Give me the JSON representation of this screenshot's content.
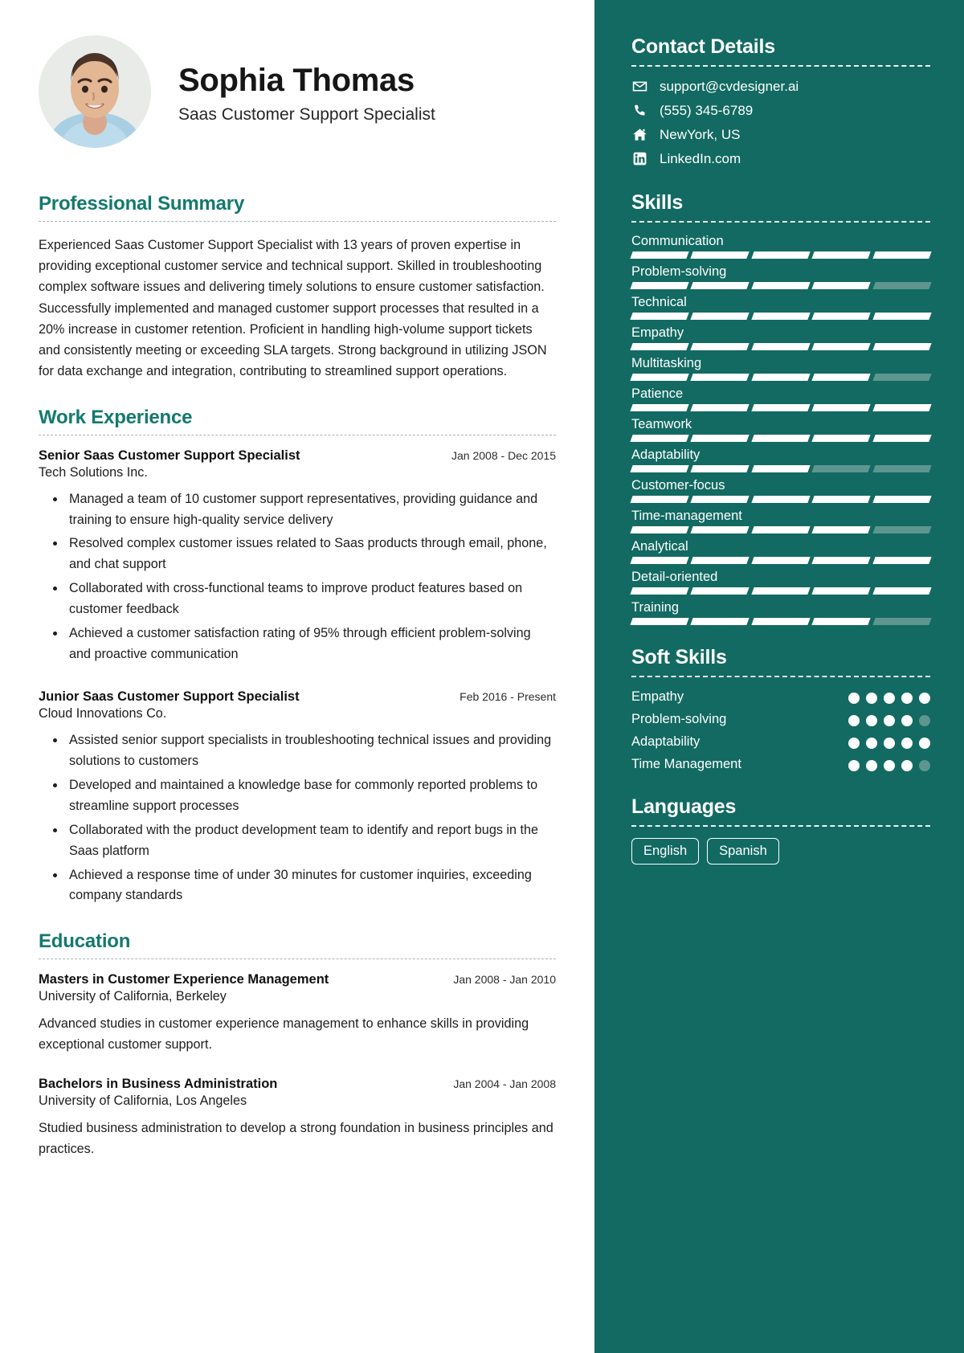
{
  "theme": {
    "accent": "#13796e",
    "sidebar_bg": "#126a62",
    "sidebar_text": "#ffffff",
    "dim": "#5e968f"
  },
  "header": {
    "name": "Sophia Thomas",
    "title": "Saas Customer Support Specialist",
    "avatar_icon": "profile-photo"
  },
  "summary": {
    "heading": "Professional Summary",
    "text": "Experienced Saas Customer Support Specialist with 13 years of proven expertise in providing exceptional customer service and technical support. Skilled in troubleshooting complex software issues and delivering timely solutions to ensure customer satisfaction. Successfully implemented and managed customer support processes that resulted in a 20% increase in customer retention. Proficient in handling high-volume support tickets and consistently meeting or exceeding SLA targets. Strong background in utilizing JSON for data exchange and integration, contributing to streamlined support operations."
  },
  "experience": {
    "heading": "Work Experience",
    "entries": [
      {
        "title": "Senior Saas Customer Support Specialist",
        "date": "Jan 2008 - Dec 2015",
        "org": "Tech Solutions Inc.",
        "bullets": [
          "Managed a team of 10 customer support representatives, providing guidance and training to ensure high-quality service delivery",
          "Resolved complex customer issues related to Saas products through email, phone, and chat support",
          "Collaborated with cross-functional teams to improve product features based on customer feedback",
          "Achieved a customer satisfaction rating of 95% through efficient problem-solving and proactive communication"
        ]
      },
      {
        "title": "Junior Saas Customer Support Specialist",
        "date": "Feb 2016 - Present",
        "org": "Cloud Innovations Co.",
        "bullets": [
          "Assisted senior support specialists in troubleshooting technical issues and providing solutions to customers",
          "Developed and maintained a knowledge base for commonly reported problems to streamline support processes",
          "Collaborated with the product development team to identify and report bugs in the Saas platform",
          "Achieved a response time of under 30 minutes for customer inquiries, exceeding company standards"
        ]
      }
    ]
  },
  "education": {
    "heading": "Education",
    "entries": [
      {
        "title": "Masters in Customer Experience Management",
        "date": "Jan 2008 - Jan 2010",
        "org": "University of California, Berkeley",
        "desc": "Advanced studies in customer experience management to enhance skills in providing exceptional customer support."
      },
      {
        "title": "Bachelors in Business Administration",
        "date": "Jan 2004 - Jan 2008",
        "org": "University of California, Los Angeles",
        "desc": "Studied business administration to develop a strong foundation in business principles and practices."
      }
    ]
  },
  "contact": {
    "heading": "Contact Details",
    "items": [
      {
        "icon": "email-icon",
        "value": "support@cvdesigner.ai"
      },
      {
        "icon": "phone-icon",
        "value": "(555) 345-6789"
      },
      {
        "icon": "home-icon",
        "value": "NewYork, US"
      },
      {
        "icon": "linkedin-icon",
        "value": "LinkedIn.com"
      }
    ]
  },
  "skills": {
    "heading": "Skills",
    "segments_total": 5,
    "items": [
      {
        "name": "Communication",
        "filled": 5
      },
      {
        "name": "Problem-solving",
        "filled": 4
      },
      {
        "name": "Technical",
        "filled": 5
      },
      {
        "name": "Empathy",
        "filled": 5
      },
      {
        "name": "Multitasking",
        "filled": 4
      },
      {
        "name": "Patience",
        "filled": 5
      },
      {
        "name": "Teamwork",
        "filled": 5
      },
      {
        "name": "Adaptability",
        "filled": 3
      },
      {
        "name": "Customer-focus",
        "filled": 5
      },
      {
        "name": "Time-management",
        "filled": 4
      },
      {
        "name": "Analytical",
        "filled": 5
      },
      {
        "name": "Detail-oriented",
        "filled": 5
      },
      {
        "name": "Training",
        "filled": 4
      }
    ]
  },
  "soft_skills": {
    "heading": "Soft Skills",
    "dots_total": 5,
    "items": [
      {
        "name": "Empathy",
        "filled": 5
      },
      {
        "name": "Problem-solving",
        "filled": 4
      },
      {
        "name": "Adaptability",
        "filled": 5
      },
      {
        "name": "Time Management",
        "filled": 4
      }
    ]
  },
  "languages": {
    "heading": "Languages",
    "items": [
      "English",
      "Spanish"
    ]
  }
}
